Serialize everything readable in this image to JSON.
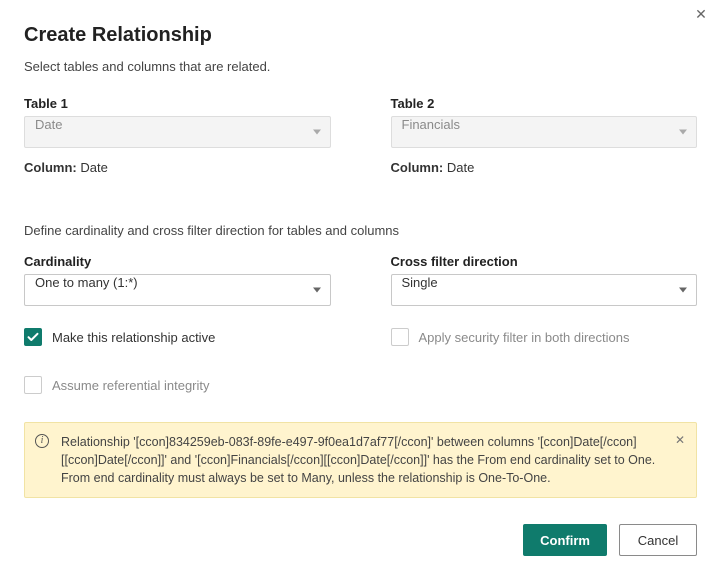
{
  "title": "Create Relationship",
  "subtitle": "Select tables and columns that are related.",
  "close_icon": "✕",
  "table1": {
    "label": "Table 1",
    "value": "Date",
    "column_label": "Column:",
    "column_value": "Date"
  },
  "table2": {
    "label": "Table 2",
    "value": "Financials",
    "column_label": "Column:",
    "column_value": "Date"
  },
  "section2_text": "Define cardinality and cross filter direction for tables and columns",
  "cardinality": {
    "label": "Cardinality",
    "value": "One to many (1:*)"
  },
  "crossfilter": {
    "label": "Cross filter direction",
    "value": "Single"
  },
  "check_active": {
    "label": "Make this relationship active",
    "checked": true
  },
  "check_security": {
    "label": "Apply security filter in both directions",
    "checked": false,
    "disabled": true
  },
  "check_integrity": {
    "label": "Assume referential integrity",
    "checked": false,
    "disabled": true
  },
  "message": {
    "text": "Relationship '[ccon]834259eb-083f-89fe-e497-9f0ea1d7af77[/ccon]' between columns '[ccon]Date[/ccon][[ccon]Date[/ccon]]' and '[ccon]Financials[/ccon][[ccon]Date[/ccon]]' has the From end cardinality set to One. From end cardinality must always be set to Many, unless the relationship is One-To-One."
  },
  "buttons": {
    "confirm": "Confirm",
    "cancel": "Cancel"
  }
}
